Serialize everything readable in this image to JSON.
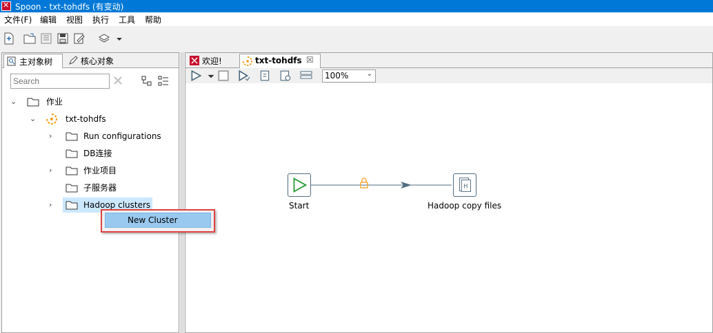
{
  "window": {
    "title": "Spoon - txt-tohdfs (有变动)"
  },
  "menubar": {
    "items": [
      "文件(F)",
      "编辑",
      "视图",
      "执行",
      "工具",
      "帮助"
    ]
  },
  "left_panel": {
    "tabs": [
      {
        "label": "主对象树"
      },
      {
        "label": "核心对象"
      }
    ],
    "search": {
      "placeholder": "Search",
      "value": ""
    },
    "tree": {
      "root": {
        "label": "作业"
      },
      "job": {
        "label": "txt-tohdfs"
      },
      "children": [
        {
          "label": "Run configurations"
        },
        {
          "label": "DB连接"
        },
        {
          "label": "作业项目"
        },
        {
          "label": "子服务器"
        },
        {
          "label": "Hadoop clusters"
        }
      ]
    }
  },
  "context_menu": {
    "items": [
      {
        "label": "New Cluster"
      }
    ]
  },
  "right_panel": {
    "tabs": [
      {
        "label": "欢迎!"
      },
      {
        "label": "txt-tohdfs"
      }
    ],
    "zoom": "100%"
  },
  "canvas": {
    "steps": [
      {
        "label": "Start"
      },
      {
        "label": "Hadoop copy files"
      }
    ]
  }
}
